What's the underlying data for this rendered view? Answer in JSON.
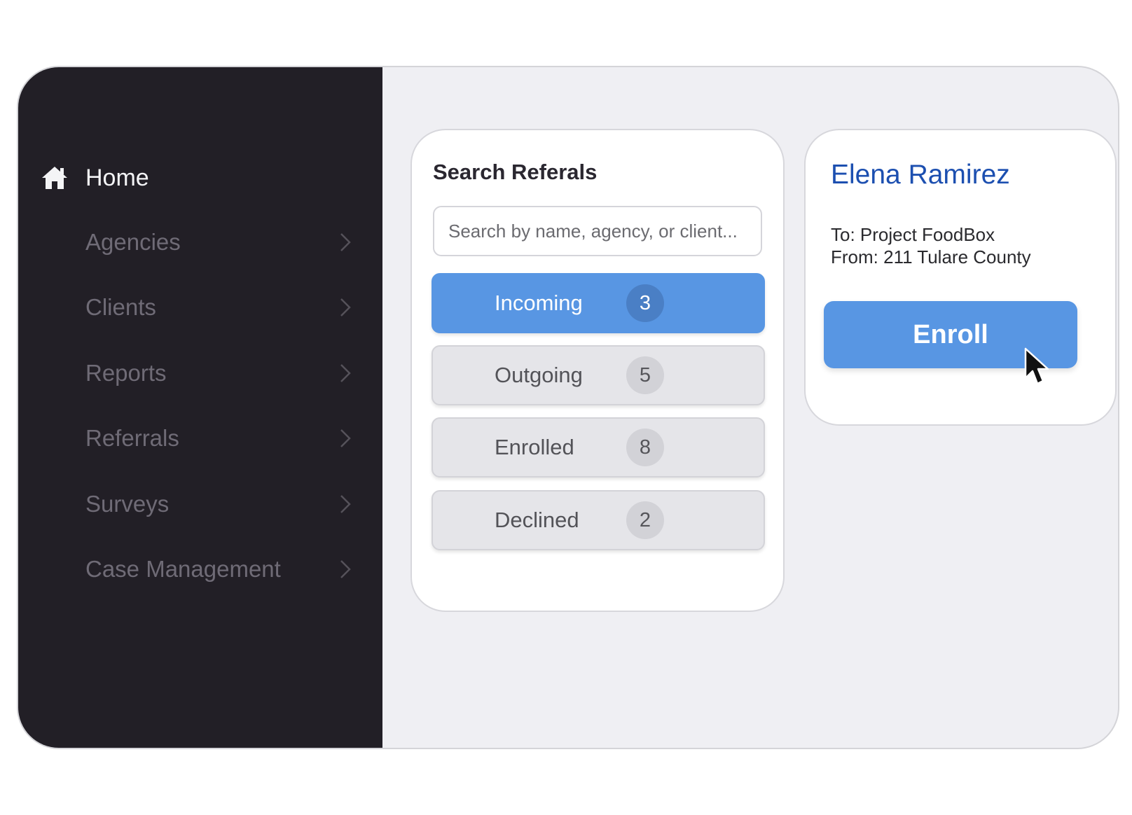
{
  "sidebar": {
    "home": {
      "label": "Home",
      "icon": "home-icon"
    },
    "items": [
      {
        "label": "Agencies",
        "icon": "chevron-right-icon"
      },
      {
        "label": "Clients",
        "icon": "chevron-right-icon"
      },
      {
        "label": "Reports",
        "icon": "chevron-right-icon"
      },
      {
        "label": "Referrals",
        "icon": "chevron-right-icon"
      },
      {
        "label": "Surveys",
        "icon": "chevron-right-icon"
      },
      {
        "label": "Case Management",
        "icon": "chevron-right-icon"
      }
    ]
  },
  "search": {
    "title": "Search Referals",
    "placeholder": "Search by name, agency, or client...",
    "value": ""
  },
  "filters": [
    {
      "label": "Incoming",
      "count": "3",
      "active": true
    },
    {
      "label": "Outgoing",
      "count": "5",
      "active": false
    },
    {
      "label": "Enrolled",
      "count": "8",
      "active": false
    },
    {
      "label": "Declined",
      "count": "2",
      "active": false
    }
  ],
  "detail": {
    "client_name": "Elena Ramirez",
    "to": "To: Project FoodBox",
    "from": "From: 211 Tulare County",
    "enroll_label": "Enroll"
  },
  "colors": {
    "sidebar_bg": "#221f26",
    "accent": "#5896e3",
    "name_color": "#1c4fb0",
    "content_bg": "#efeff3"
  }
}
